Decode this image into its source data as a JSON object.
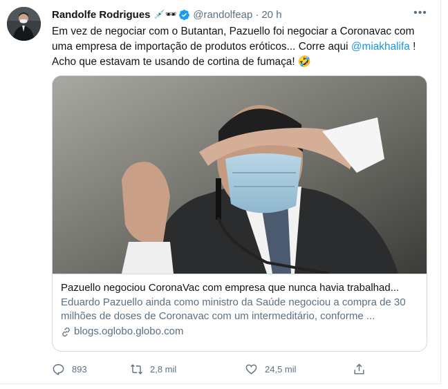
{
  "author": {
    "name": "Randolfe Rodrigues",
    "emoji_badges": "💉🕶",
    "handle": "@randolfeap",
    "separator": "·",
    "time": "20 h"
  },
  "tweet": {
    "text_before": "Em vez de negociar com o Butantan, Pazuello foi negociar a Coronavac com uma empresa de importação de produtos eróticos... Corre aqui ",
    "mention": "@miakhalifa",
    "text_after": " ! Acho que estavam te usando de cortina de fumaça! 🤣"
  },
  "card": {
    "title": "Pazuello negociou CoronaVac com empresa que nunca havia trabalhad...",
    "description": "Eduardo Pazuello ainda como ministro da Saúde negociou a compra de 30 milhões de doses de Coronavac com um intermeditário, conforme ...",
    "domain": "blogs.oglobo.globo.com"
  },
  "actions": {
    "replies": "893",
    "retweets": "2,8 mil",
    "likes": "24,5 mil"
  },
  "icons": {
    "verified": "verified-badge-icon",
    "more": "more-options-icon",
    "reply": "reply-icon",
    "retweet": "retweet-icon",
    "like": "heart-icon",
    "share": "share-icon",
    "link": "link-icon"
  },
  "colors": {
    "accent": "#1b95e0",
    "secondary_text": "#5b7083",
    "border": "#cfd9de"
  }
}
